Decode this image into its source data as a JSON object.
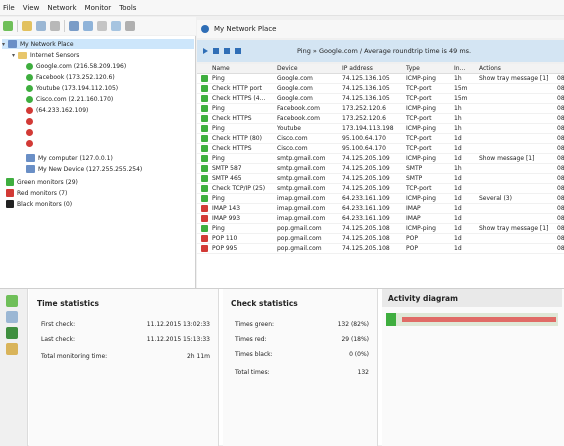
{
  "menu": [
    "File",
    "View",
    "Network",
    "Monitor",
    "Tools"
  ],
  "window_title": "My Network Place",
  "info": {
    "message": "Ping » Google.com / Average roundtrip time is 49 ms."
  },
  "tree": {
    "root": "My Network Place",
    "folder": "Internet Sensors",
    "items": [
      {
        "label": "Google.com (216.58.209.196)",
        "status": "green",
        "kind": "dot"
      },
      {
        "label": "Facebook (173.252.120.6)",
        "status": "green",
        "kind": "dot"
      },
      {
        "label": "Youtube (173.194.112.105)",
        "status": "green",
        "kind": "dot"
      },
      {
        "label": "Cisco.com (2.21.160.170)",
        "status": "green",
        "kind": "dot"
      },
      {
        "label": "(64.233.162.109)",
        "status": "red",
        "kind": "dot"
      },
      {
        "label": "",
        "status": "red",
        "kind": "dot"
      },
      {
        "label": "",
        "status": "red",
        "kind": "dot"
      },
      {
        "label": "",
        "status": "red",
        "kind": "dot"
      },
      {
        "label": "My computer (127.0.0.1)",
        "status": "green",
        "kind": "net"
      },
      {
        "label": "My New Device (127.255.255.254)",
        "status": "green",
        "kind": "net"
      },
      {
        "label": "Green monitors (29)",
        "status": "green",
        "kind": "sq"
      },
      {
        "label": "Red monitors (7)",
        "status": "red",
        "kind": "sq"
      },
      {
        "label": "Black monitors (0)",
        "status": "black",
        "kind": "sq"
      }
    ]
  },
  "grid": {
    "headers": [
      "",
      "Name",
      "Device",
      "IP address",
      "Type",
      "In...",
      "Actions",
      ""
    ],
    "rows": [
      [
        "green",
        "Ping",
        "Google.com",
        "74.125.136.105",
        "ICMP-ping",
        "1h",
        "Show tray message [1]",
        "08"
      ],
      [
        "green",
        "Check HTTP port",
        "Google.com",
        "74.125.136.105",
        "TCP-port",
        "15m",
        "",
        "08"
      ],
      [
        "green",
        "Check HTTPS (4...",
        "Google.com",
        "74.125.136.105",
        "TCP-port",
        "15m",
        "",
        "08"
      ],
      [
        "green",
        "Ping",
        "Facebook.com",
        "173.252.120.6",
        "ICMP-ping",
        "1h",
        "",
        "08"
      ],
      [
        "green",
        "Check HTTPS",
        "Facebook.com",
        "173.252.120.6",
        "TCP-port",
        "1h",
        "",
        "08"
      ],
      [
        "green",
        "Ping",
        "Youtube",
        "173.194.113.198",
        "ICMP-ping",
        "1h",
        "",
        "08"
      ],
      [
        "green",
        "Check HTTP (80)",
        "Cisco.com",
        "95.100.64.170",
        "TCP-port",
        "1d",
        "",
        "08"
      ],
      [
        "green",
        "Check HTTPS",
        "Cisco.com",
        "95.100.64.170",
        "TCP-port",
        "1d",
        "",
        "08"
      ],
      [
        "green",
        "Ping",
        "smtp.gmail.com",
        "74.125.205.109",
        "ICMP-ping",
        "1d",
        "Show message [1]",
        "08"
      ],
      [
        "green",
        "SMTP 587",
        "smtp.gmail.com",
        "74.125.205.109",
        "SMTP",
        "1h",
        "",
        "08"
      ],
      [
        "green",
        "SMTP 465",
        "smtp.gmail.com",
        "74.125.205.109",
        "SMTP",
        "1d",
        "",
        "08"
      ],
      [
        "green",
        "Check TCP/IP (25)",
        "smtp.gmail.com",
        "74.125.205.109",
        "TCP-port",
        "1d",
        "",
        "08"
      ],
      [
        "green",
        "Ping",
        "imap.gmail.com",
        "64.233.161.109",
        "ICMP-ping",
        "1d",
        "Several (3)",
        "08"
      ],
      [
        "red",
        "IMAP 143",
        "imap.gmail.com",
        "64.233.161.109",
        "IMAP",
        "1d",
        "",
        "08"
      ],
      [
        "red",
        "IMAP 993",
        "imap.gmail.com",
        "64.233.161.109",
        "IMAP",
        "1d",
        "",
        "08"
      ],
      [
        "green",
        "Ping",
        "pop.gmail.com",
        "74.125.205.108",
        "ICMP-ping",
        "1d",
        "Show tray message [1]",
        "08"
      ],
      [
        "red",
        "POP 110",
        "pop.gmail.com",
        "74.125.205.108",
        "POP",
        "1d",
        "",
        "08"
      ],
      [
        "red",
        "POP 995",
        "pop.gmail.com",
        "74.125.205.108",
        "POP",
        "1d",
        "",
        "08"
      ]
    ]
  },
  "time_stats": {
    "title": "Time statistics",
    "rows": [
      {
        "label": "First check:",
        "value": "11.12.2015 13:02:33"
      },
      {
        "label": "Last check:",
        "value": "11.12.2015 15:13:33"
      },
      {
        "label": "Total monitoring time:",
        "value": "2h 11m"
      }
    ]
  },
  "check_stats": {
    "title": "Check statistics",
    "rows": [
      {
        "label": "Times green:",
        "value": "132 (82%)"
      },
      {
        "label": "Times red:",
        "value": "29 (18%)"
      },
      {
        "label": "Times black:",
        "value": "0 (0%)"
      },
      {
        "label": "Total times:",
        "value": "132"
      }
    ]
  },
  "activity": {
    "title": "Activity diagram",
    "green_share": 0.82,
    "red_share": 0.18
  },
  "colors": {
    "green": "#3fae3f",
    "red": "#d23a36",
    "black": "#222222",
    "accent": "#2f6eb6"
  }
}
